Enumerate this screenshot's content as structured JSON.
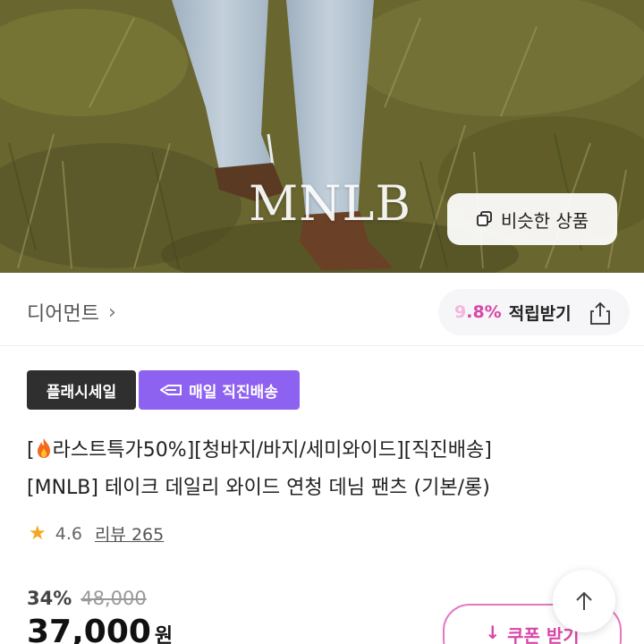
{
  "hero": {
    "brand_watermark": "MNLB",
    "similar_button_label": "비슷한 상품"
  },
  "store": {
    "name": "디어먼트",
    "chevron": "›",
    "reward_rate_lead": "9",
    "reward_rate_rest": ".8%",
    "reward_label": "적립받기"
  },
  "badges": {
    "flash_sale": "플래시세일",
    "daily_delivery": "매일 직진배송"
  },
  "product": {
    "title_line1_open": "[",
    "title_line1_rest": "라스트특가50%][청바지/바지/세미와이드][직진배송]",
    "title_line2": "[MNLB] 테이크 데일리 와이드 연청 데님 팬츠 (기본/롱)"
  },
  "rating": {
    "star": "★",
    "score": "4.6",
    "reviews": "리뷰 265"
  },
  "price": {
    "discount": "34%",
    "original": "48,000",
    "sale": "37,000",
    "unit": "원"
  },
  "actions": {
    "coupon_label": "쿠폰 받기",
    "coupon_icon": "↓",
    "top_icon": "↑"
  },
  "icons": {
    "similar": "copy-icon",
    "share": "share-icon",
    "fire": "fire-icon",
    "delivery": "delivery-truck-icon",
    "scroll_top": "arrow-up-icon",
    "coupon": "download-icon"
  },
  "colors": {
    "accent_pink": "#d946a8",
    "delivery_purple": "#8e62f0",
    "flash_dark": "#2f2f2f",
    "star": "#f5a623"
  }
}
